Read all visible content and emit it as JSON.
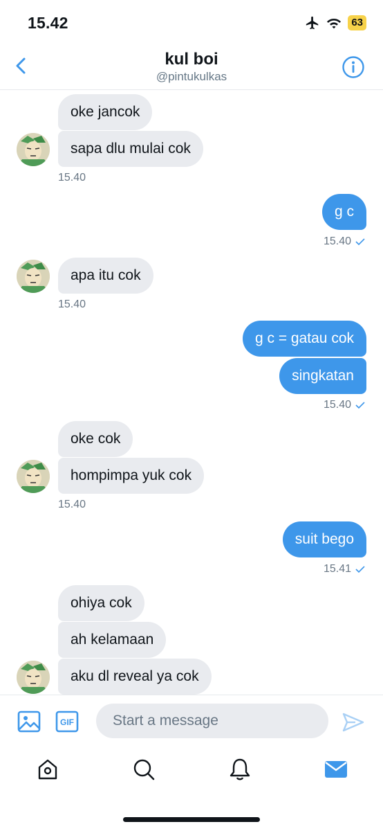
{
  "status_bar": {
    "time": "15.42",
    "battery": "63",
    "icons": [
      "airplane-icon",
      "wifi-icon",
      "battery-icon"
    ]
  },
  "header": {
    "name": "kul boi",
    "handle": "@pintukulkas",
    "back_icon": "chevron-left-icon",
    "info_icon": "info-icon"
  },
  "colors": {
    "accent": "#3e97ea",
    "incoming_bubble": "#e9ebef",
    "timestamp": "#687684",
    "battery": "#f7d24a"
  },
  "messages": [
    {
      "dir": "in",
      "text": "oke jancok"
    },
    {
      "dir": "in",
      "text": "sapa dlu mulai cok",
      "time": "15.40"
    },
    {
      "dir": "out",
      "text": "g c",
      "time": "15.40"
    },
    {
      "dir": "in",
      "text": "apa itu cok",
      "time": "15.40"
    },
    {
      "dir": "out",
      "text": "g c = gatau cok"
    },
    {
      "dir": "out",
      "text": "singkatan",
      "time": "15.40"
    },
    {
      "dir": "in",
      "text": "oke cok"
    },
    {
      "dir": "in",
      "text": "hompimpa yuk cok",
      "time": "15.40"
    },
    {
      "dir": "out",
      "text": "suit bego",
      "time": "15.41"
    },
    {
      "dir": "in",
      "text": "ohiya cok"
    },
    {
      "dir": "in",
      "text": "ah kelamaan"
    },
    {
      "dir": "in",
      "text": "aku dl reveal ya cok"
    }
  ],
  "composer": {
    "placeholder": "Start a message",
    "media_icon": "image-icon",
    "gif_label": "GIF",
    "send_icon": "send-icon"
  },
  "tabbar": {
    "items": [
      "home-icon",
      "search-icon",
      "notifications-icon",
      "messages-icon"
    ],
    "active": "messages-icon"
  }
}
